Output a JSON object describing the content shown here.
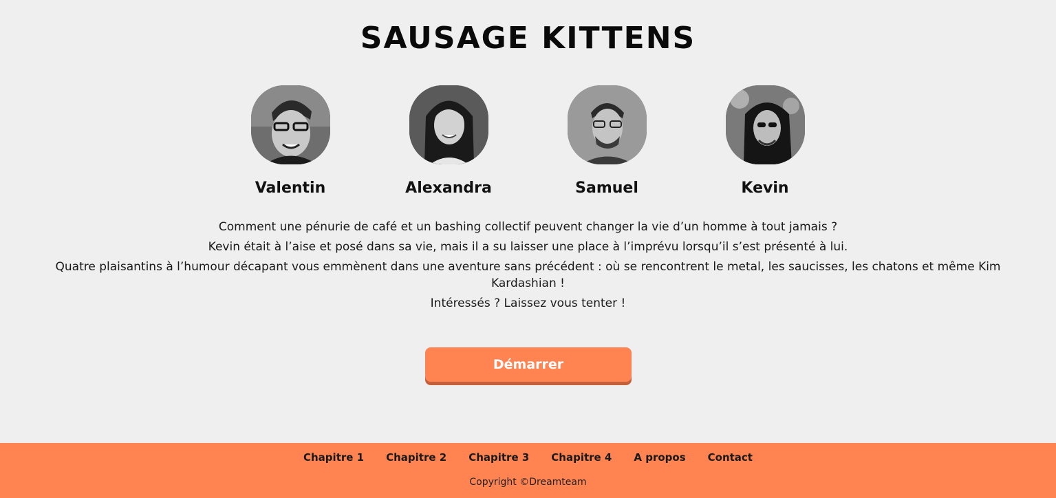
{
  "header": {
    "title": "SAUSAGE KITTENS"
  },
  "team": [
    {
      "name": "Valentin",
      "avatar_icon": "person-photo"
    },
    {
      "name": "Alexandra",
      "avatar_icon": "person-photo"
    },
    {
      "name": "Samuel",
      "avatar_icon": "person-photo"
    },
    {
      "name": "Kevin",
      "avatar_icon": "person-photo"
    }
  ],
  "intro": {
    "lines": [
      "Comment une pénurie de café et un bashing collectif peuvent changer la vie d’un homme à tout jamais ?",
      "Kevin était à l’aise et posé dans sa vie, mais il a su laisser une place à l’imprévu lorsqu’il s’est présenté à lui.",
      "Quatre plaisantins à l’humour décapant vous emmènent dans une aventure sans précédent : où se rencontrent le metal, les saucisses, les chatons et même Kim Kardashian !",
      "Intéressés ? Laissez vous tenter !"
    ]
  },
  "cta": {
    "label": "Démarrer"
  },
  "footer": {
    "links": [
      "Chapitre 1",
      "Chapitre 2",
      "Chapitre 3",
      "Chapitre 4",
      "A propos",
      "Contact"
    ],
    "copyright": "Copyright ©Dreamteam"
  },
  "colors": {
    "background": "#efefef",
    "accent": "#ff8452",
    "accent_shadow": "#c4603a"
  }
}
